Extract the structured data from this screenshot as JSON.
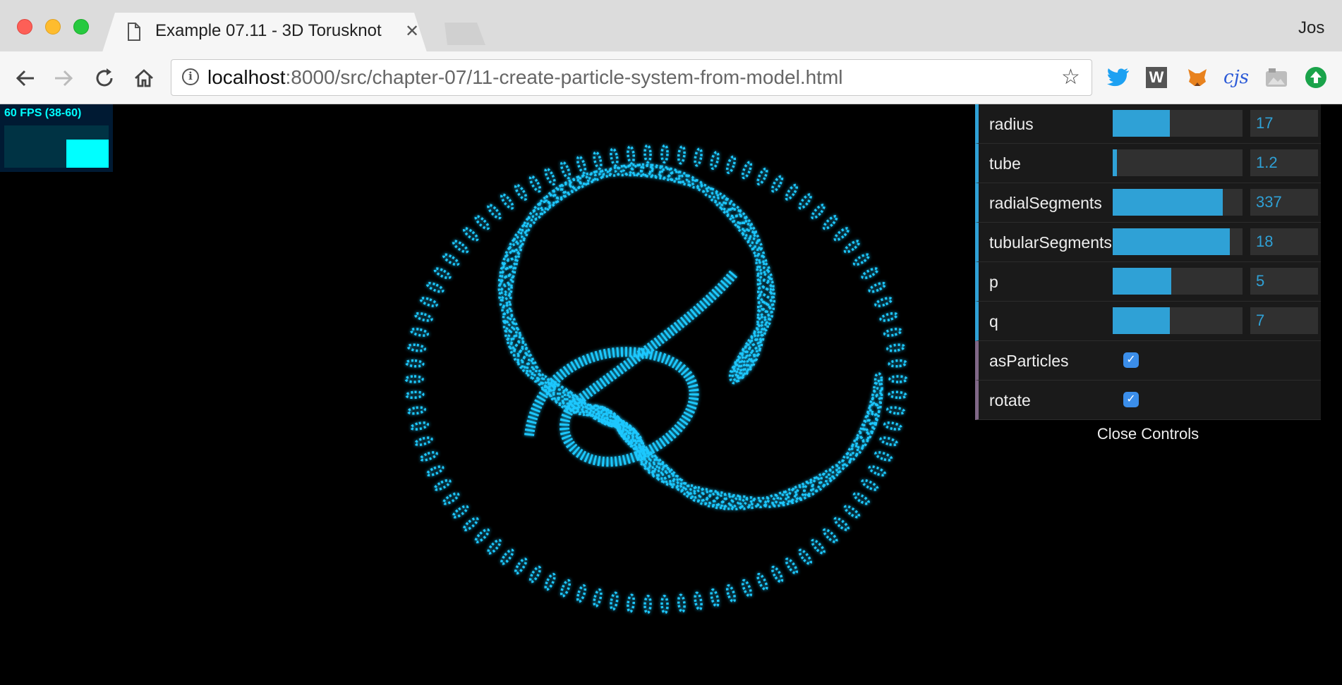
{
  "browser": {
    "tab_title": "Example 07.11 - 3D Torusknot",
    "profile_name": "Jos",
    "url_host": "localhost",
    "url_rest": ":8000/src/chapter-07/11-create-particle-system-from-model.html",
    "extensions": [
      "twitter-icon",
      "w-extension-icon",
      "fox-extension-icon",
      "cjs-icon",
      "screenshot-extension-icon",
      "upload-extension-icon"
    ],
    "ext_w_label": "W",
    "ext_cjs_label": "cjs"
  },
  "stats": {
    "fps_text": "60 FPS (38-60)"
  },
  "controls": {
    "rows": [
      {
        "label": "radius",
        "value": "17",
        "fill": 0.44
      },
      {
        "label": "tube",
        "value": "1.2",
        "fill": 0.03
      },
      {
        "label": "radialSegments",
        "value": "337",
        "fill": 0.85
      },
      {
        "label": "tubularSegments",
        "value": "18",
        "fill": 0.9
      },
      {
        "label": "p",
        "value": "5",
        "fill": 0.45
      },
      {
        "label": "q",
        "value": "7",
        "fill": 0.44
      }
    ],
    "checks": [
      {
        "label": "asParticles",
        "checked": true
      },
      {
        "label": "rotate",
        "checked": true
      }
    ],
    "close_label": "Close Controls"
  },
  "colors": {
    "accent": "#2fa1d6",
    "particle": "#1ec8ff",
    "stats": "#00ffff"
  }
}
